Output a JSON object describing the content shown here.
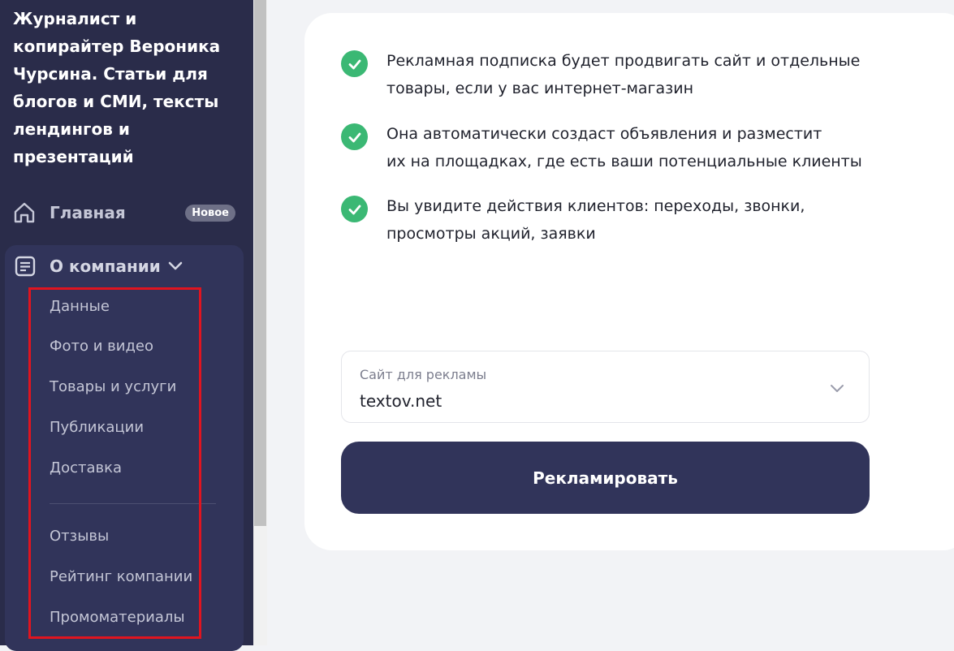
{
  "sidebar": {
    "company_title": "Журналист и копирайтер Вероника Чурсина. Статьи для блогов и СМИ, тексты лендингов и презентаций",
    "home": {
      "label": "Главная",
      "badge": "Новое",
      "icon": "home-icon"
    },
    "company": {
      "label": "О компании",
      "icon": "document-icon",
      "chevron_icon": "chevron-down-icon",
      "items": [
        {
          "label": "Данные"
        },
        {
          "label": "Фото и видео"
        },
        {
          "label": "Товары и услуги"
        },
        {
          "label": "Публикации"
        },
        {
          "label": "Доставка"
        },
        {
          "label": "Отзывы"
        },
        {
          "label": "Рейтинг компании"
        },
        {
          "label": "Промоматериалы"
        }
      ]
    }
  },
  "main": {
    "features": [
      {
        "icon": "check-icon",
        "line1": "Рекламная подписка будет продвигать сайт и отдельные",
        "line2": "товары, если у вас интернет-магазин"
      },
      {
        "icon": "check-icon",
        "line1": "Она автоматически создаст объявления и разместит",
        "line2": "их на площадках, где есть ваши потенциальные клиенты"
      },
      {
        "icon": "check-icon",
        "line1": "Вы увидите действия клиентов: переходы, звонки,",
        "line2": "просмотры акций, заявки"
      }
    ],
    "site_select": {
      "label": "Сайт для рекламы",
      "value": "textov.net"
    },
    "promote_button": "Рекламировать"
  },
  "colors": {
    "sidebar_bg": "#2a2c4a",
    "accent_dark": "#31345a",
    "check_green": "#3bb874",
    "highlight_red": "#e0141f"
  }
}
